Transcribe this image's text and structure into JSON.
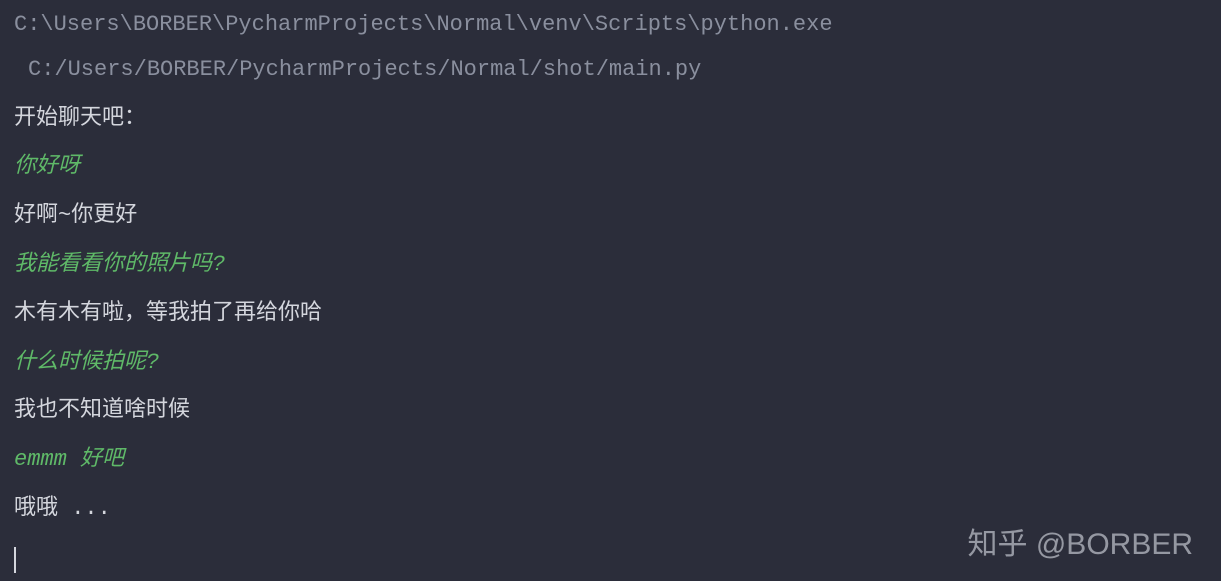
{
  "header": {
    "interpreter_path": "C:\\Users\\BORBER\\PycharmProjects\\Normal\\venv\\Scripts\\python.exe",
    "script_path": "C:/Users/BORBER/PycharmProjects/Normal/shot/main.py"
  },
  "conversation": {
    "prompt_start": "开始聊天吧：",
    "lines": [
      {
        "role": "user",
        "text": "你好呀"
      },
      {
        "role": "bot",
        "text": "好啊~你更好"
      },
      {
        "role": "user",
        "text": "我能看看你的照片吗?"
      },
      {
        "role": "bot",
        "text": "木有木有啦，等我拍了再给你哈"
      },
      {
        "role": "user",
        "text": "什么时候拍呢?"
      },
      {
        "role": "bot",
        "text": "我也不知道啥时候"
      },
      {
        "role": "user",
        "text": "emmm 好吧"
      },
      {
        "role": "bot",
        "text": "哦哦 ..."
      }
    ]
  },
  "watermark": "知乎 @BORBER"
}
